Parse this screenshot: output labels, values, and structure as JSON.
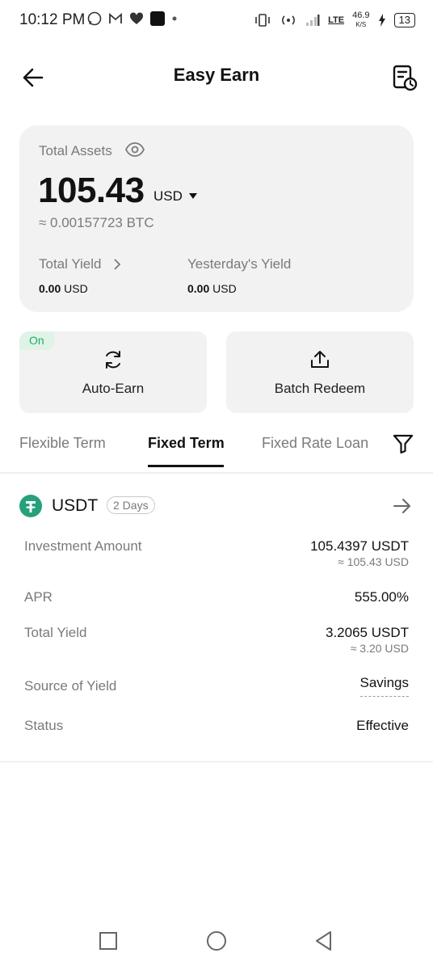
{
  "status_bar": {
    "time": "10:12 PM",
    "network_type": "LTE",
    "speed_value": "46.9",
    "speed_unit": "K/S",
    "battery": "13",
    "icons": [
      "whatsapp-icon",
      "gmail-icon",
      "heart-icon",
      "square-app-icon",
      "dot-icon",
      "vibrate-icon",
      "hotspot-icon",
      "signal-icon",
      "charging-icon"
    ]
  },
  "header": {
    "title": "Easy Earn"
  },
  "assets": {
    "label": "Total Assets",
    "amount": "105.43",
    "currency": "USD",
    "btc_equiv": "≈ 0.00157723 BTC",
    "total_yield_label": "Total Yield",
    "total_yield_value": "0.00",
    "total_yield_unit": "USD",
    "yesterday_yield_label": "Yesterday's Yield",
    "yesterday_yield_value": "0.00",
    "yesterday_yield_unit": "USD"
  },
  "actions": {
    "auto_earn_badge": "On",
    "auto_earn_label": "Auto-Earn",
    "batch_redeem_label": "Batch Redeem"
  },
  "tabs": {
    "flexible": "Flexible Term",
    "fixed": "Fixed Term",
    "fixed_rate_loan": "Fixed Rate Loan",
    "active": "Fixed Term"
  },
  "product": {
    "coin": "USDT",
    "term": "2 Days",
    "investment_label": "Investment Amount",
    "investment_value": "105.4397 USDT",
    "investment_sub": "≈ 105.43 USD",
    "apr_label": "APR",
    "apr_value": "555.00%",
    "total_yield_label": "Total Yield",
    "total_yield_value": "3.2065 USDT",
    "total_yield_sub": "≈ 3.20 USD",
    "source_label": "Source of Yield",
    "source_value": "Savings",
    "status_label": "Status",
    "status_value": "Effective"
  },
  "colors": {
    "accent_green": "#1eae6a",
    "tether_green": "#26a17b",
    "card_bg": "#f2f2f2"
  }
}
